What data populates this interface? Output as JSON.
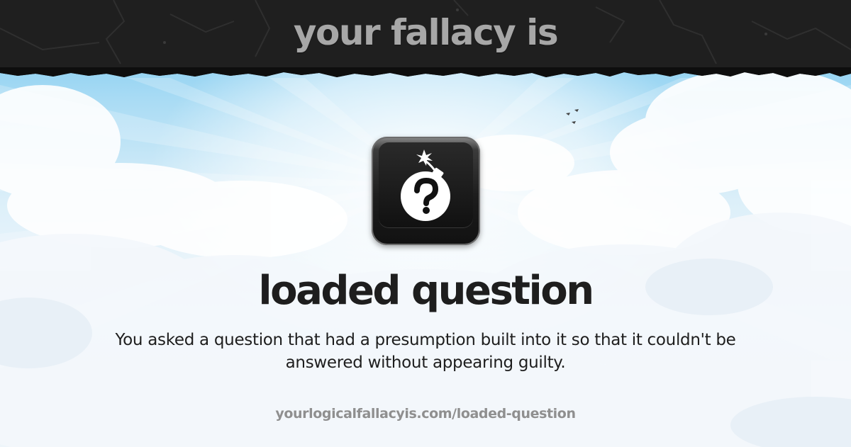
{
  "header": {
    "title": "your fallacy is"
  },
  "fallacy": {
    "icon": "bomb-question-icon",
    "name": "loaded question",
    "description": "You asked a question that had a presumption built into it so that it couldn't be answered without appearing guilty.",
    "url": "yourlogicalfallacyis.com/loaded-question"
  },
  "colors": {
    "header_band": "#1f1f1f",
    "header_text": "#a7a7a7",
    "sky_top": "#6cc3ee",
    "sky_bottom": "#eef5fa",
    "name_text": "#1e1e1e",
    "url_text": "#8f8f8f"
  }
}
